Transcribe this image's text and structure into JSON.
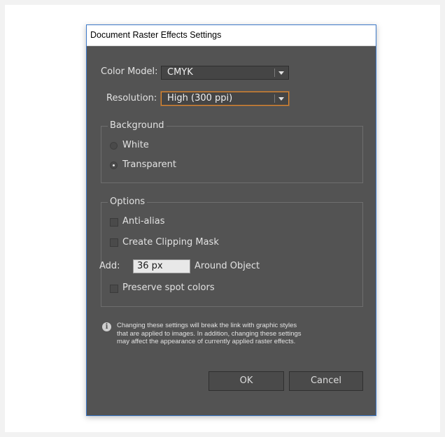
{
  "dialog": {
    "title": "Document Raster Effects Settings",
    "color_model": {
      "label": "Color Model:",
      "value": "CMYK"
    },
    "resolution": {
      "label": "Resolution:",
      "value": "High (300 ppi)"
    },
    "background": {
      "legend": "Background",
      "options": [
        {
          "label": "White",
          "selected": false
        },
        {
          "label": "Transparent",
          "selected": true
        }
      ]
    },
    "options": {
      "legend": "Options",
      "anti_alias": {
        "label": "Anti-alias",
        "checked": false
      },
      "clipping_mask": {
        "label": "Create Clipping Mask",
        "checked": false
      },
      "add": {
        "label": "Add:",
        "value": "36 px",
        "suffix": "Around Object"
      },
      "preserve_spot": {
        "label": "Preserve spot colors",
        "checked": false
      }
    },
    "info_lines": [
      "Changing these settings will break the link with graphic styles",
      "that are applied to images. In addition, changing these settings",
      "may affect the appearance of currently applied raster effects."
    ],
    "buttons": {
      "ok": "OK",
      "cancel": "Cancel"
    }
  },
  "colors": {
    "dialog_bg": "#535353",
    "focus_accent": "#e1872c",
    "window_border": "#3c78c8"
  },
  "icons": {
    "info": "info-icon"
  }
}
